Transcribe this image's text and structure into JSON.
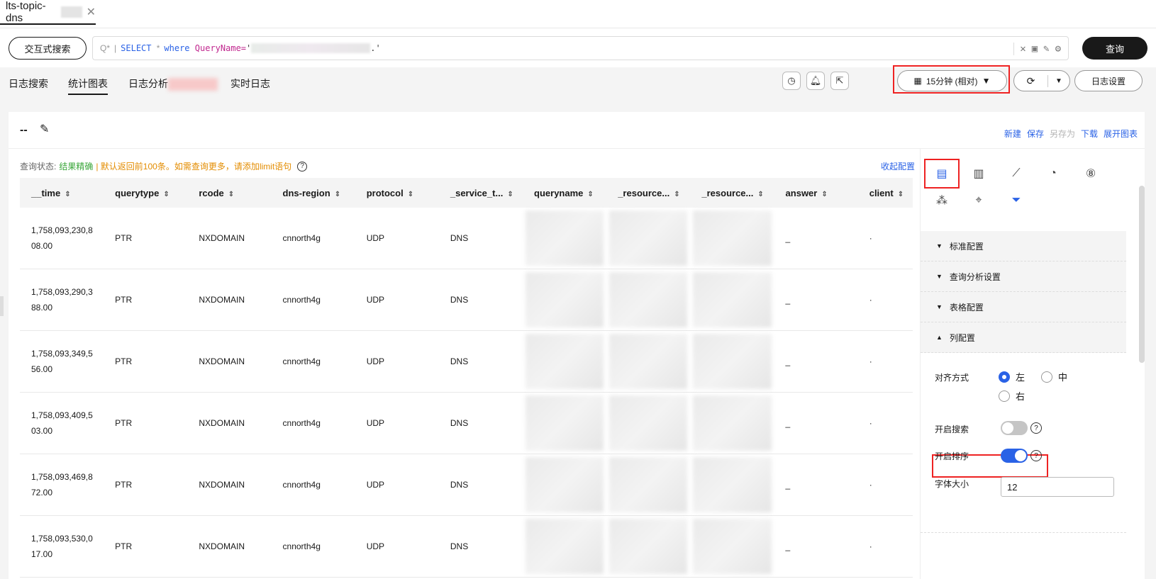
{
  "tab": {
    "title": "lts-topic-dns",
    "close": "✕"
  },
  "query": {
    "interactive_label": "交互式搜索",
    "placeholder_icon": "Q*",
    "bar": "|",
    "kw_select": "SELECT",
    "star": "*",
    "kw_where": "where",
    "column": "QueryName=",
    "quote_open": "'",
    "quote_close": ".'",
    "submit_label": "查询"
  },
  "subtabs": [
    "日志搜索",
    "统计图表",
    "日志分析",
    "实时日志"
  ],
  "time_range": "15分钟 (相对)",
  "log_settings": "日志设置",
  "chart": {
    "title": "--",
    "actions": {
      "new": "新建",
      "save": "保存",
      "save_as": "另存为",
      "download": "下载",
      "expand": "展开图表"
    }
  },
  "status": {
    "label": "查询状态:",
    "ok": "结果精确",
    "warn": "| 默认返回前100条。如需查询更多，请添加limit语句",
    "collapse": "收起配置"
  },
  "table": {
    "columns": [
      "__time",
      "querytype",
      "rcode",
      "dns-region",
      "protocol",
      "_service_t...",
      "queryname",
      "_resource...",
      "_resource...",
      "answer",
      "client"
    ],
    "rows": [
      {
        "time_a": "1,758,093,230,8",
        "time_b": "08.00",
        "querytype": "PTR",
        "rcode": "NXDOMAIN",
        "region": "cnnorth4g",
        "protocol": "UDP",
        "service": "DNS",
        "answer": "_",
        "client": "·"
      },
      {
        "time_a": "1,758,093,290,3",
        "time_b": "88.00",
        "querytype": "PTR",
        "rcode": "NXDOMAIN",
        "region": "cnnorth4g",
        "protocol": "UDP",
        "service": "DNS",
        "answer": "_",
        "client": "·"
      },
      {
        "time_a": "1,758,093,349,5",
        "time_b": "56.00",
        "querytype": "PTR",
        "rcode": "NXDOMAIN",
        "region": "cnnorth4g",
        "protocol": "UDP",
        "service": "DNS",
        "answer": "_",
        "client": "·"
      },
      {
        "time_a": "1,758,093,409,5",
        "time_b": "03.00",
        "querytype": "PTR",
        "rcode": "NXDOMAIN",
        "region": "cnnorth4g",
        "protocol": "UDP",
        "service": "DNS",
        "answer": "_",
        "client": "·"
      },
      {
        "time_a": "1,758,093,469,8",
        "time_b": "72.00",
        "querytype": "PTR",
        "rcode": "NXDOMAIN",
        "region": "cnnorth4g",
        "protocol": "UDP",
        "service": "DNS",
        "answer": "_",
        "client": "·"
      },
      {
        "time_a": "1,758,093,530,0",
        "time_b": "17.00",
        "querytype": "PTR",
        "rcode": "NXDOMAIN",
        "region": "cnnorth4g",
        "protocol": "UDP",
        "service": "DNS",
        "answer": "_",
        "client": "·"
      }
    ]
  },
  "config": {
    "sections": [
      {
        "label": "标准配置",
        "expanded": false
      },
      {
        "label": "查询分析设置",
        "expanded": false
      },
      {
        "label": "表格配置",
        "expanded": false
      },
      {
        "label": "列配置",
        "expanded": true
      }
    ],
    "align_label": "对齐方式",
    "align_left": "左",
    "align_center": "中",
    "align_right": "右",
    "align_selected": "左",
    "search_label": "开启搜索",
    "search_enabled": false,
    "sort_label": "开启排序",
    "sort_enabled": true,
    "font_size_label": "字体大小",
    "font_size": "12"
  },
  "colors": {
    "accent": "#2a62e6",
    "highlight": "#e22222",
    "ok": "#3aa63a",
    "warn": "#e38c00"
  }
}
